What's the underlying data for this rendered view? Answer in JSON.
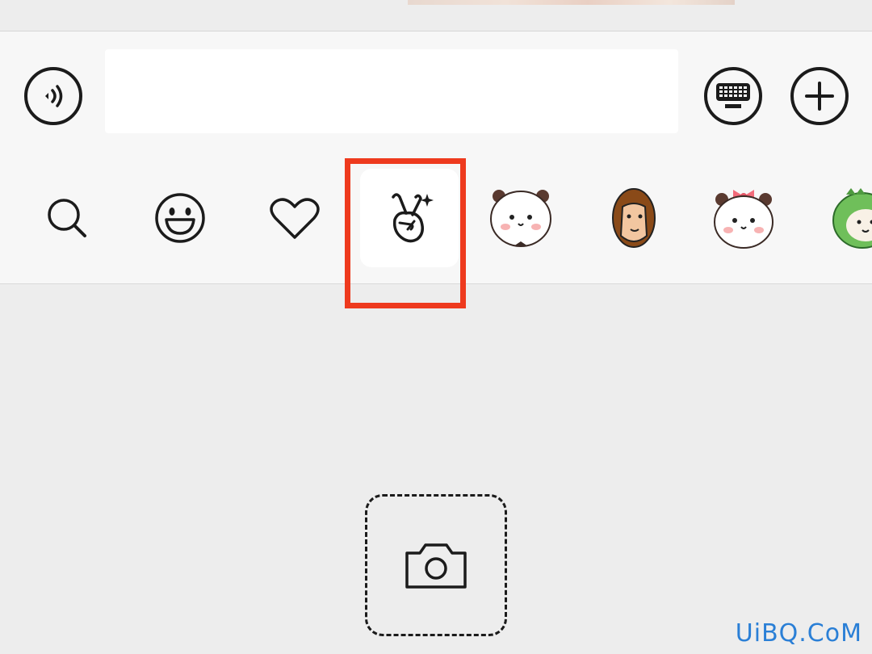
{
  "chat_input": {
    "voice_icon": "voice-wave-icon",
    "text_value": "",
    "keyboard_icon": "keyboard-icon",
    "plus_icon": "plus-icon"
  },
  "emoji_tabs": [
    {
      "icon": "search-icon"
    },
    {
      "icon": "smiley-icon"
    },
    {
      "icon": "heart-icon"
    },
    {
      "icon": "peace-hand-sparkle-icon",
      "selected": true
    },
    {
      "icon": "panda-sticker-icon"
    },
    {
      "icon": "man-sticker-icon"
    },
    {
      "icon": "panda-bow-sticker-icon"
    },
    {
      "icon": "green-dino-sticker-icon"
    }
  ],
  "highlight_color": "#ee3a1e",
  "camera": {
    "icon": "camera-icon"
  },
  "watermark": "UiBQ.CoM"
}
